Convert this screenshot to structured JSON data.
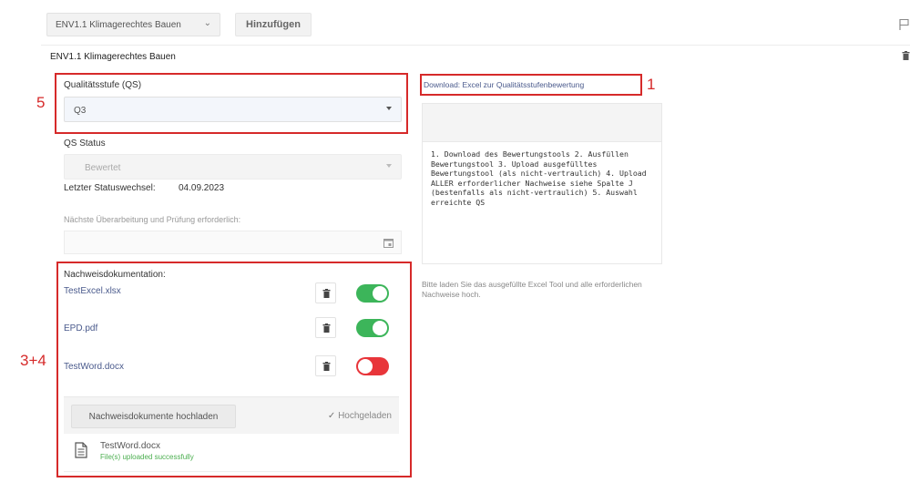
{
  "toolbar": {
    "dropdown_label": "ENV1.1 Klimagerechtes Bauen",
    "dropdown_chevron": "⌄",
    "add_label": "Hinzufügen"
  },
  "section": {
    "title": "ENV1.1 Klimagerechtes Bauen"
  },
  "annotations": {
    "one": "1",
    "five": "5",
    "three_four": "3+4",
    "color": "#d62a2a"
  },
  "form": {
    "qs_label": "Qualitätsstufe (QS)",
    "qs_value": "Q3",
    "status_label": "QS Status",
    "status_value": "Bewertet",
    "last_change_label": "Letzter Statuswechsel:",
    "last_change_value": "04.09.2023",
    "next_review_label": "Nächste Überarbeitung und Prüfung erforderlich:",
    "next_review_value": ""
  },
  "docs": {
    "label": "Nachweisdokumentation:",
    "files": [
      {
        "name": "TestExcel.xlsx",
        "toggle": "on"
      },
      {
        "name": "EPD.pdf",
        "toggle": "on"
      },
      {
        "name": "TestWord.docx",
        "toggle": "off"
      }
    ],
    "upload_button": "Nachweisdokumente hochladen",
    "uploaded_label": "Hochgeladen",
    "uploaded_check": "✓",
    "uploaded_file": "TestWord.docx",
    "uploaded_message": "File(s) uploaded successfully"
  },
  "right": {
    "download_link": "Download: Excel zur Qualitätsstufenbewertung",
    "instructions": "1. Download des Bewertungstools 2. Ausfüllen Bewertungstool 3. Upload ausgefülltes Bewertungstool (als nicht-vertraulich) 4. Upload ALLER erforderlicher Nachweise siehe Spalte J (bestenfalls als nicht-vertraulich) 5. Auswahl erreichte QS",
    "hint": "Bitte laden Sie das ausgefüllte Excel Tool und alle erforderlichen Nachweise hoch."
  },
  "colors": {
    "toggle_on": "#3cb55a",
    "toggle_off": "#e8353a",
    "link": "#4a5a8c",
    "success": "#4caf50"
  }
}
